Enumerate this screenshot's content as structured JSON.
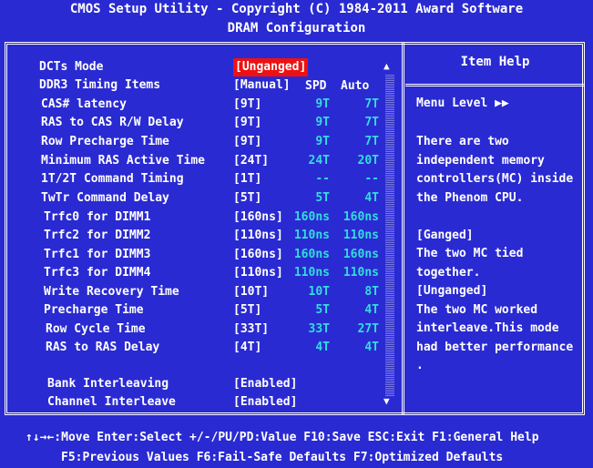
{
  "header": {
    "title": "CMOS Setup Utility - Copyright (C) 1984-2011 Award Software",
    "subtitle": "DRAM Configuration"
  },
  "columns": {
    "spd": "SPD",
    "auto": "Auto"
  },
  "settings": [
    {
      "label": "DCTs Mode",
      "value": "[Unganged]",
      "spd": "",
      "auto": ""
    },
    {
      "label": "DDR3 Timing Items",
      "value": "[Manual]",
      "spd": "",
      "auto": ""
    },
    {
      "label": "CAS# latency",
      "value": "[9T]",
      "spd": "9T",
      "auto": "7T"
    },
    {
      "label": "RAS to CAS R/W Delay",
      "value": "[9T]",
      "spd": "9T",
      "auto": "7T"
    },
    {
      "label": "Row Precharge Time",
      "value": "[9T]",
      "spd": "9T",
      "auto": "7T"
    },
    {
      "label": "Minimum RAS Active Time",
      "value": "[24T]",
      "spd": "24T",
      "auto": "20T"
    },
    {
      "label": "1T/2T Command Timing",
      "value": "[1T]",
      "spd": "--",
      "auto": "--"
    },
    {
      "label": "TwTr Command Delay",
      "value": "[5T]",
      "spd": "5T",
      "auto": "4T"
    },
    {
      "label": "Trfc0 for DIMM1",
      "value": "[160ns]",
      "spd": "160ns",
      "auto": "160ns"
    },
    {
      "label": "Trfc2 for DIMM2",
      "value": "[110ns]",
      "spd": "110ns",
      "auto": "110ns"
    },
    {
      "label": "Trfc1 for DIMM3",
      "value": "[160ns]",
      "spd": "160ns",
      "auto": "160ns"
    },
    {
      "label": "Trfc3 for DIMM4",
      "value": "[110ns]",
      "spd": "110ns",
      "auto": "110ns"
    },
    {
      "label": "Write Recovery Time",
      "value": "[10T]",
      "spd": "10T",
      "auto": "8T"
    },
    {
      "label": "Precharge Time",
      "value": "[5T]",
      "spd": "5T",
      "auto": "4T"
    },
    {
      "label": "Row Cycle Time",
      "value": "[33T]",
      "spd": "33T",
      "auto": "27T"
    },
    {
      "label": "RAS to RAS Delay",
      "value": "[4T]",
      "spd": "4T",
      "auto": "4T"
    },
    {
      "label": "Bank Interleaving",
      "value": "[Enabled]",
      "spd": "",
      "auto": ""
    },
    {
      "label": "Channel Interleave",
      "value": "[Enabled]",
      "spd": "",
      "auto": ""
    }
  ],
  "help": {
    "title": "Item Help",
    "menu_level": "Menu Level   ▶▶",
    "lines": [
      "There are two",
      "independent memory",
      "controllers(MC) inside",
      "the Phenom CPU.",
      "",
      "[Ganged]",
      "The two MC tied",
      "together.",
      "[Unganged]",
      "The two MC worked",
      "interleave.This mode",
      "had better performance",
      "."
    ]
  },
  "footer": {
    "line1": "↑↓→←:Move  Enter:Select  +/-/PU/PD:Value  F10:Save  ESC:Exit  F1:General Help",
    "line2": "F5:Previous Values  F6:Fail-Safe Defaults  F7:Optimized Defaults"
  },
  "colors": {
    "background": "#2a2ad2",
    "highlight": "#ee1111",
    "secondary_text": "#33dddd"
  }
}
